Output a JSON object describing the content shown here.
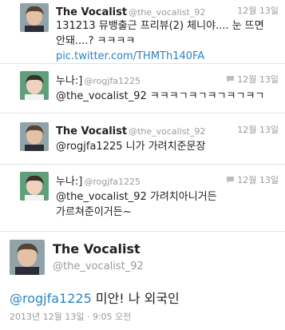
{
  "tweets": [
    {
      "name": "The Vocalist",
      "handle": "@the_vocalist_92",
      "date": "12월 13일",
      "lines": [
        "131213 뮤뱅출근 프리뷰(2) 체니야.... 눈 뜨면",
        "안돼....? ㅋㅋㅋㅋ "
      ],
      "link": "pic.twitter.com/THMTh140FA",
      "avatar_color": "#6a5a4a"
    },
    {
      "name": "누나:]",
      "handle": "@rogjfa1225",
      "date": "12월 13일",
      "lines": [
        "@the_vocalist_92 ㅋㅋㅋㄱㅋㄱㅋㄱㅋㄱㅋㄱ"
      ],
      "avatar_color": "#4a8a6a"
    },
    {
      "name": "The Vocalist",
      "handle": "@the_vocalist_92",
      "date": "12월 13일",
      "lines": [
        "@rogjfa1225 니가 가려치준문장"
      ],
      "avatar_color": "#6a5a4a"
    },
    {
      "name": "누나:]",
      "handle": "@rogjfa1225",
      "date": "12월 13일",
      "lines": [
        "@the_vocalist_92 가려치아니거든",
        "가르쳐준이거든~"
      ],
      "avatar_color": "#4a8a6a"
    }
  ],
  "focused": {
    "name": "The Vocalist",
    "handle": "@the_vocalist_92",
    "mention": "@rogjfa1225",
    "text": " 미안! 나 외국인",
    "meta": "2013년 12월 13일 · 9:05 오전"
  },
  "colors": {
    "link": "#2a84c7",
    "muted": "#9a9a9a"
  },
  "icons": {
    "reply_indicator": "speech-bubble-icon"
  }
}
